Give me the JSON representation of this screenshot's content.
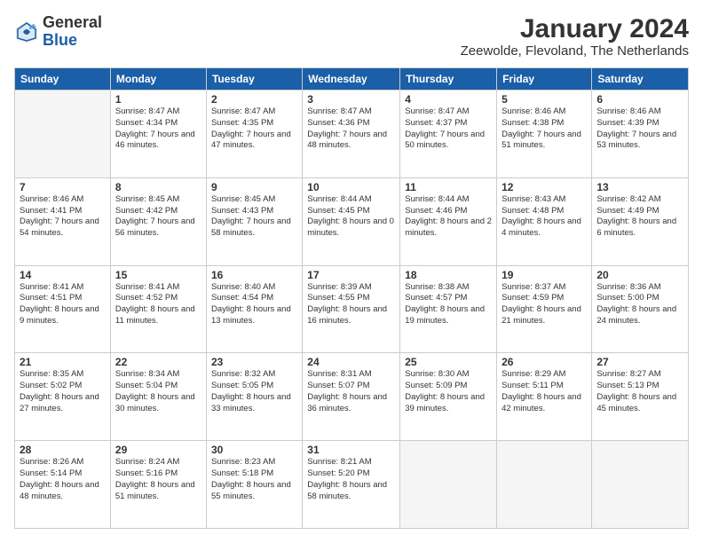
{
  "logo": {
    "general": "General",
    "blue": "Blue"
  },
  "title": "January 2024",
  "subtitle": "Zeewolde, Flevoland, The Netherlands",
  "days_header": [
    "Sunday",
    "Monday",
    "Tuesday",
    "Wednesday",
    "Thursday",
    "Friday",
    "Saturday"
  ],
  "weeks": [
    [
      {
        "num": "",
        "empty": true
      },
      {
        "num": "1",
        "sunrise": "Sunrise: 8:47 AM",
        "sunset": "Sunset: 4:34 PM",
        "daylight": "Daylight: 7 hours and 46 minutes."
      },
      {
        "num": "2",
        "sunrise": "Sunrise: 8:47 AM",
        "sunset": "Sunset: 4:35 PM",
        "daylight": "Daylight: 7 hours and 47 minutes."
      },
      {
        "num": "3",
        "sunrise": "Sunrise: 8:47 AM",
        "sunset": "Sunset: 4:36 PM",
        "daylight": "Daylight: 7 hours and 48 minutes."
      },
      {
        "num": "4",
        "sunrise": "Sunrise: 8:47 AM",
        "sunset": "Sunset: 4:37 PM",
        "daylight": "Daylight: 7 hours and 50 minutes."
      },
      {
        "num": "5",
        "sunrise": "Sunrise: 8:46 AM",
        "sunset": "Sunset: 4:38 PM",
        "daylight": "Daylight: 7 hours and 51 minutes."
      },
      {
        "num": "6",
        "sunrise": "Sunrise: 8:46 AM",
        "sunset": "Sunset: 4:39 PM",
        "daylight": "Daylight: 7 hours and 53 minutes."
      }
    ],
    [
      {
        "num": "7",
        "sunrise": "Sunrise: 8:46 AM",
        "sunset": "Sunset: 4:41 PM",
        "daylight": "Daylight: 7 hours and 54 minutes."
      },
      {
        "num": "8",
        "sunrise": "Sunrise: 8:45 AM",
        "sunset": "Sunset: 4:42 PM",
        "daylight": "Daylight: 7 hours and 56 minutes."
      },
      {
        "num": "9",
        "sunrise": "Sunrise: 8:45 AM",
        "sunset": "Sunset: 4:43 PM",
        "daylight": "Daylight: 7 hours and 58 minutes."
      },
      {
        "num": "10",
        "sunrise": "Sunrise: 8:44 AM",
        "sunset": "Sunset: 4:45 PM",
        "daylight": "Daylight: 8 hours and 0 minutes."
      },
      {
        "num": "11",
        "sunrise": "Sunrise: 8:44 AM",
        "sunset": "Sunset: 4:46 PM",
        "daylight": "Daylight: 8 hours and 2 minutes."
      },
      {
        "num": "12",
        "sunrise": "Sunrise: 8:43 AM",
        "sunset": "Sunset: 4:48 PM",
        "daylight": "Daylight: 8 hours and 4 minutes."
      },
      {
        "num": "13",
        "sunrise": "Sunrise: 8:42 AM",
        "sunset": "Sunset: 4:49 PM",
        "daylight": "Daylight: 8 hours and 6 minutes."
      }
    ],
    [
      {
        "num": "14",
        "sunrise": "Sunrise: 8:41 AM",
        "sunset": "Sunset: 4:51 PM",
        "daylight": "Daylight: 8 hours and 9 minutes."
      },
      {
        "num": "15",
        "sunrise": "Sunrise: 8:41 AM",
        "sunset": "Sunset: 4:52 PM",
        "daylight": "Daylight: 8 hours and 11 minutes."
      },
      {
        "num": "16",
        "sunrise": "Sunrise: 8:40 AM",
        "sunset": "Sunset: 4:54 PM",
        "daylight": "Daylight: 8 hours and 13 minutes."
      },
      {
        "num": "17",
        "sunrise": "Sunrise: 8:39 AM",
        "sunset": "Sunset: 4:55 PM",
        "daylight": "Daylight: 8 hours and 16 minutes."
      },
      {
        "num": "18",
        "sunrise": "Sunrise: 8:38 AM",
        "sunset": "Sunset: 4:57 PM",
        "daylight": "Daylight: 8 hours and 19 minutes."
      },
      {
        "num": "19",
        "sunrise": "Sunrise: 8:37 AM",
        "sunset": "Sunset: 4:59 PM",
        "daylight": "Daylight: 8 hours and 21 minutes."
      },
      {
        "num": "20",
        "sunrise": "Sunrise: 8:36 AM",
        "sunset": "Sunset: 5:00 PM",
        "daylight": "Daylight: 8 hours and 24 minutes."
      }
    ],
    [
      {
        "num": "21",
        "sunrise": "Sunrise: 8:35 AM",
        "sunset": "Sunset: 5:02 PM",
        "daylight": "Daylight: 8 hours and 27 minutes."
      },
      {
        "num": "22",
        "sunrise": "Sunrise: 8:34 AM",
        "sunset": "Sunset: 5:04 PM",
        "daylight": "Daylight: 8 hours and 30 minutes."
      },
      {
        "num": "23",
        "sunrise": "Sunrise: 8:32 AM",
        "sunset": "Sunset: 5:05 PM",
        "daylight": "Daylight: 8 hours and 33 minutes."
      },
      {
        "num": "24",
        "sunrise": "Sunrise: 8:31 AM",
        "sunset": "Sunset: 5:07 PM",
        "daylight": "Daylight: 8 hours and 36 minutes."
      },
      {
        "num": "25",
        "sunrise": "Sunrise: 8:30 AM",
        "sunset": "Sunset: 5:09 PM",
        "daylight": "Daylight: 8 hours and 39 minutes."
      },
      {
        "num": "26",
        "sunrise": "Sunrise: 8:29 AM",
        "sunset": "Sunset: 5:11 PM",
        "daylight": "Daylight: 8 hours and 42 minutes."
      },
      {
        "num": "27",
        "sunrise": "Sunrise: 8:27 AM",
        "sunset": "Sunset: 5:13 PM",
        "daylight": "Daylight: 8 hours and 45 minutes."
      }
    ],
    [
      {
        "num": "28",
        "sunrise": "Sunrise: 8:26 AM",
        "sunset": "Sunset: 5:14 PM",
        "daylight": "Daylight: 8 hours and 48 minutes."
      },
      {
        "num": "29",
        "sunrise": "Sunrise: 8:24 AM",
        "sunset": "Sunset: 5:16 PM",
        "daylight": "Daylight: 8 hours and 51 minutes."
      },
      {
        "num": "30",
        "sunrise": "Sunrise: 8:23 AM",
        "sunset": "Sunset: 5:18 PM",
        "daylight": "Daylight: 8 hours and 55 minutes."
      },
      {
        "num": "31",
        "sunrise": "Sunrise: 8:21 AM",
        "sunset": "Sunset: 5:20 PM",
        "daylight": "Daylight: 8 hours and 58 minutes."
      },
      {
        "num": "",
        "empty": true
      },
      {
        "num": "",
        "empty": true
      },
      {
        "num": "",
        "empty": true
      }
    ]
  ]
}
